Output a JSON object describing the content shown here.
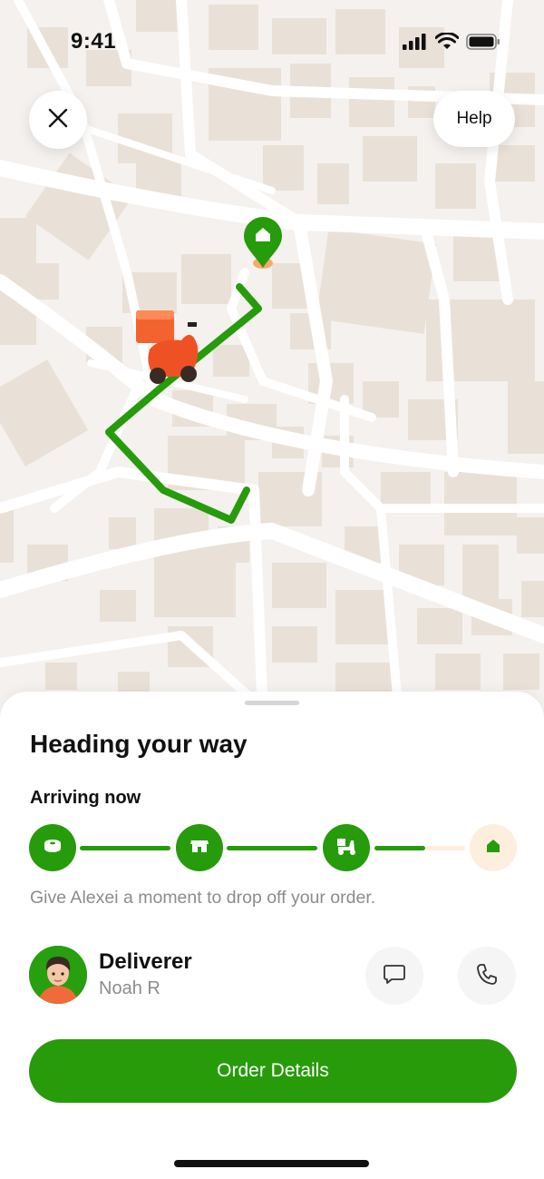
{
  "status_bar": {
    "time": "9:41"
  },
  "map": {
    "close_icon": "close-icon",
    "help_label": "Help",
    "destination_icon": "home-pin-icon",
    "courier_icon": "scooter-icon",
    "route_color": "#269b0b"
  },
  "sheet": {
    "title": "Heading your way",
    "eta_label": "Arriving now",
    "steps": [
      {
        "icon": "order-icon",
        "state": "done"
      },
      {
        "icon": "store-icon",
        "state": "done"
      },
      {
        "icon": "scooter-icon",
        "state": "done"
      },
      {
        "icon": "home-icon",
        "state": "pending"
      }
    ],
    "message": "Give Alexei a moment to drop off your order.",
    "deliverer": {
      "role": "Deliverer",
      "name": "Noah R"
    },
    "chat_icon": "chat-icon",
    "call_icon": "phone-icon",
    "order_button": "Order Details"
  },
  "colors": {
    "accent": "#269b0b",
    "pending": "#fdeede",
    "muted_text": "#8c8c8c"
  }
}
